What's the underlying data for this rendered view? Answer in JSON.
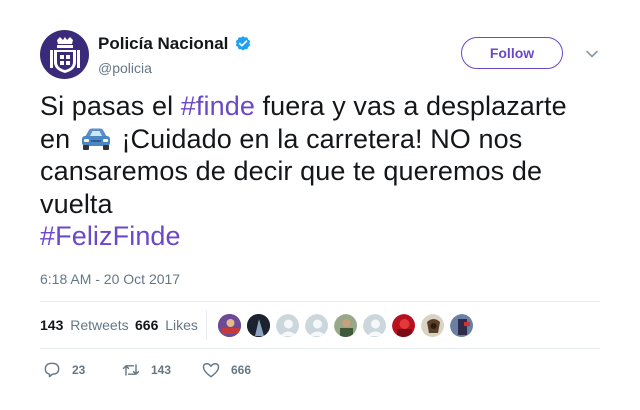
{
  "profile": {
    "display_name": "Policía Nacional",
    "handle": "@policia",
    "verified": true,
    "avatar_icon": "police-badge-icon",
    "avatar_color": "#3b2a7a"
  },
  "follow_label": "Follow",
  "tweet": {
    "line1_pre": "Si pasas el ",
    "hashtag1": "#finde",
    "line1_post": " fuera y vas a desplazarte",
    "line2_pre": "en ",
    "line2_post": " ¡Cuidado en la carretera! NO nos cansaremos de decir que te queremos de vuelta",
    "hashtag2": "#FelizFinde",
    "emoji_icon": "car-icon"
  },
  "timestamp": "6:18 AM - 20 Oct 2017",
  "stats": {
    "retweets_count": "143",
    "retweets_label": "Retweets",
    "likes_count": "666",
    "likes_label": "Likes"
  },
  "actions": {
    "reply_count": "23",
    "retweet_count": "143",
    "like_count": "666"
  },
  "colors": {
    "accent": "#6b48c8",
    "verified": "#1da1f2",
    "muted": "#657786"
  }
}
